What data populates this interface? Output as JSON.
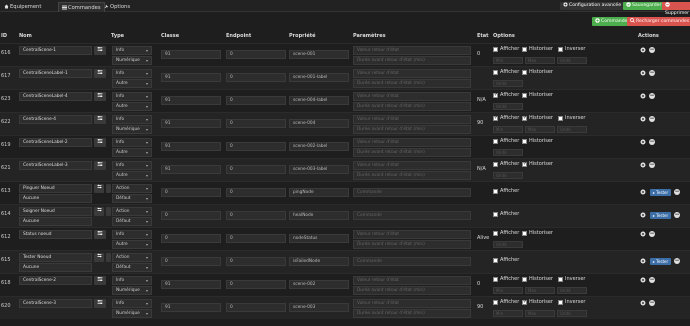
{
  "tabs": [
    {
      "label": "Equipement",
      "icon": "home-icon"
    },
    {
      "label": "Commandes",
      "icon": "list-icon"
    },
    {
      "label": "Options",
      "icon": "wrench-icon"
    }
  ],
  "toolbar": {
    "config_label": "Configuration avancée",
    "save_label": "Sauvegarder",
    "delete_label": "Supprimer"
  },
  "header_buttons": {
    "add_label": "Commandes",
    "reload_label": "Recharger commandes"
  },
  "columns": {
    "id": "ID",
    "nom": "Nom",
    "type": "Type",
    "classe": "Classe",
    "endpoint": "Endpoint",
    "propriete": "Propriété",
    "parametres": "Paramètres",
    "etat": "Etat",
    "options": "Options",
    "actions": "Actions"
  },
  "labels": {
    "afficher": "Afficher",
    "historiser": "Historiser",
    "inverser": "Inverser",
    "min": "Min",
    "max": "Max",
    "unite": "Unité",
    "tester": "Tester"
  },
  "placeholders": {
    "valeur_retour": "Valeur retour d'état",
    "duree_retour": "Durée avant retour d'état (min)",
    "commande": "Commande"
  },
  "rows": [
    {
      "id": "616",
      "nom": "CentralScene-1",
      "type": "Info",
      "subtype": "Numérique",
      "classe": "91",
      "endpoint": "0",
      "propriete": "scene-001",
      "etat": "0",
      "afficher": false,
      "historiser": false,
      "inverser": false
    },
    {
      "id": "617",
      "nom": "CentralSceneLabel-1",
      "type": "Info",
      "subtype": "Autre",
      "classe": "91",
      "endpoint": "0",
      "propriete": "scene-001-label",
      "etat": "",
      "afficher": false,
      "historiser": false
    },
    {
      "id": "623",
      "nom": "CentralSceneLabel-4",
      "type": "Info",
      "subtype": "Autre",
      "classe": "91",
      "endpoint": "0",
      "propriete": "scene-004-label",
      "etat": "N/A",
      "afficher": true,
      "historiser": false
    },
    {
      "id": "622",
      "nom": "CentralScene-4",
      "type": "Info",
      "subtype": "Numérique",
      "classe": "91",
      "endpoint": "0",
      "propriete": "scene-004",
      "etat": "90",
      "afficher": true,
      "historiser": true,
      "inverser": false
    },
    {
      "id": "619",
      "nom": "CentralSceneLabel-2",
      "type": "Info",
      "subtype": "Autre",
      "classe": "91",
      "endpoint": "0",
      "propriete": "scene-002-label",
      "etat": "",
      "afficher": false,
      "historiser": false
    },
    {
      "id": "621",
      "nom": "CentralSceneLabel-3",
      "type": "Info",
      "subtype": "Autre",
      "classe": "91",
      "endpoint": "0",
      "propriete": "scene-003-label",
      "etat": "N/A",
      "afficher": false,
      "historiser": true
    },
    {
      "id": "613",
      "nom": "Pinguer Noeud",
      "nom2": "Aucune",
      "type": "Action",
      "subtype": "Défaut",
      "classe": "0",
      "endpoint": "0",
      "propriete": "pingNode",
      "etat": "",
      "afficher": false
    },
    {
      "id": "614",
      "nom": "Soigner Noeud",
      "nom2": "Aucune",
      "type": "Action",
      "subtype": "Défaut",
      "classe": "0",
      "endpoint": "0",
      "propriete": "healNode",
      "etat": "",
      "afficher": false
    },
    {
      "id": "612",
      "nom": "Status noeud",
      "type": "Info",
      "subtype": "Autre",
      "classe": "0",
      "endpoint": "0",
      "propriete": "nodeStatus",
      "etat": "Alive",
      "afficher": false,
      "historiser": false
    },
    {
      "id": "615",
      "nom": "Tester Noeud",
      "nom2": "Aucune",
      "type": "Action",
      "subtype": "Défaut",
      "classe": "0",
      "endpoint": "0",
      "propriete": "isFailedNode",
      "etat": "",
      "afficher": false
    },
    {
      "id": "618",
      "nom": "CentralScene-2",
      "type": "Info",
      "subtype": "Numérique",
      "classe": "91",
      "endpoint": "0",
      "propriete": "scene-002",
      "etat": "0",
      "afficher": false,
      "historiser": false,
      "inverser": false
    },
    {
      "id": "620",
      "nom": "CentralScene-3",
      "type": "Info",
      "subtype": "Numérique",
      "classe": "91",
      "endpoint": "0",
      "propriete": "scene-003",
      "etat": "90",
      "afficher": false,
      "historiser": true,
      "inverser": false
    }
  ],
  "colors": {
    "green": "#4cae4c",
    "red": "#d9534f",
    "blue": "#3c6ea8",
    "dark": "#333333"
  }
}
